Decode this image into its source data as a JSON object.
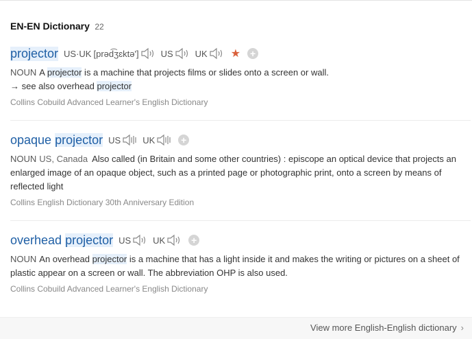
{
  "header": {
    "title": "EN-EN Dictionary",
    "count": "22"
  },
  "entries": [
    {
      "word_parts": [
        "projector"
      ],
      "phon": {
        "label": "US·UK",
        "ipa": "[prəd͡ʒɛktə']",
        "us": "US",
        "uk": "UK"
      },
      "pos": "NOUN",
      "def_before": "A ",
      "def_hl": "projector",
      "def_after": " is a machine that projects films or slides onto a screen or wall.",
      "see_prefix": "→ see also overhead ",
      "see_hl": "projector",
      "source": "Collins Cobuild Advanced Learner's English Dictionary"
    },
    {
      "word_parts": [
        "opaque",
        "projector"
      ],
      "phon": {
        "us": "US",
        "uk": "UK"
      },
      "pos": "NOUN",
      "region": "US, Canada",
      "def": "Also called (in Britain and some other countries) : episcope an optical device that projects an enlarged image of an opaque object, such as a printed page or photographic print, onto a screen by means of reflected light",
      "source": "Collins English Dictionary 30th Anniversary Edition"
    },
    {
      "word_parts": [
        "overhead",
        "projector"
      ],
      "phon": {
        "us": "US",
        "uk": "UK"
      },
      "pos": "NOUN",
      "def_before": "An overhead ",
      "def_hl": "projector",
      "def_after": " is a machine that has a light inside it and makes the writing or pictures on a sheet of plastic appear on a screen or wall. The abbreviation OHP is also used.",
      "source": "Collins Cobuild Advanced Learner's English Dictionary"
    }
  ],
  "footer": {
    "more": "View more English-English dictionary",
    "chevron": "›"
  },
  "colors": {
    "word": "#1f5fa5",
    "highlight": "#e6f0fb",
    "star": "#d9603b"
  },
  "icons": [
    "speaker-icon",
    "star-icon",
    "add-icon",
    "chevron-right-icon"
  ]
}
